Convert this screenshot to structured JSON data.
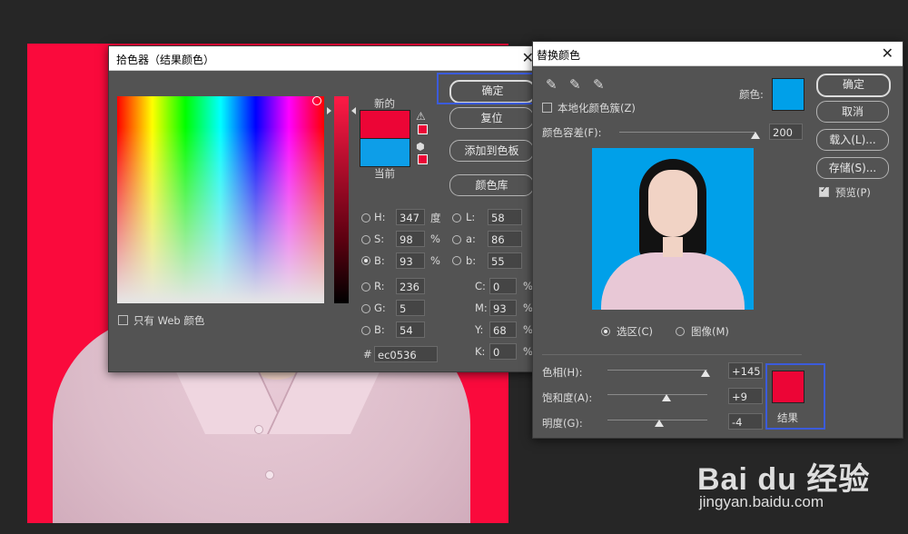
{
  "colors": {
    "new_color": "#ec0536",
    "current_color": "#0d9ee8",
    "replace_color": "#00a0e9",
    "result_color": "#ec0536",
    "highlight": "#3b5bdb"
  },
  "color_picker": {
    "title": "拾色器（结果颜色）",
    "new_label": "新的",
    "current_label": "当前",
    "buttons": {
      "ok": "确定",
      "reset": "复位",
      "add_swatch": "添加到色板",
      "libraries": "颜色库"
    },
    "web_only_label": "只有 Web 颜色",
    "fields": {
      "H": {
        "label": "H:",
        "value": "347",
        "unit": "度"
      },
      "S": {
        "label": "S:",
        "value": "98",
        "unit": "%"
      },
      "Bv": {
        "label": "B:",
        "value": "93",
        "unit": "%"
      },
      "R": {
        "label": "R:",
        "value": "236"
      },
      "G": {
        "label": "G:",
        "value": "5"
      },
      "Bl": {
        "label": "B:",
        "value": "54"
      },
      "L": {
        "label": "L:",
        "value": "58"
      },
      "a": {
        "label": "a:",
        "value": "86"
      },
      "b": {
        "label": "b:",
        "value": "55"
      },
      "C": {
        "label": "C:",
        "value": "0",
        "unit": "%"
      },
      "M": {
        "label": "M:",
        "value": "93",
        "unit": "%"
      },
      "Y": {
        "label": "Y:",
        "value": "68",
        "unit": "%"
      },
      "K": {
        "label": "K:",
        "value": "0",
        "unit": "%"
      },
      "hex_label": "#",
      "hex": "ec0536"
    }
  },
  "replace_color": {
    "title": "替换颜色",
    "localized_label": "本地化颜色簇(Z)",
    "color_label": "颜色:",
    "fuzziness_label": "颜色容差(F):",
    "fuzziness_value": "200",
    "fuzziness_fraction": 1.0,
    "selection_label": "选区(C)",
    "image_label": "图像(M)",
    "buttons": {
      "ok": "确定",
      "cancel": "取消",
      "load": "载入(L)...",
      "save": "存储(S)..."
    },
    "preview_label": "预览(P)",
    "hue_label": "色相(H):",
    "hue_value": "+145",
    "saturation_label": "饱和度(A):",
    "saturation_value": "+9",
    "lightness_label": "明度(G):",
    "lightness_value": "-4",
    "result_label": "结果"
  },
  "watermark": {
    "brand": "Bai du 经验",
    "url": "jingyan.baidu.com"
  }
}
